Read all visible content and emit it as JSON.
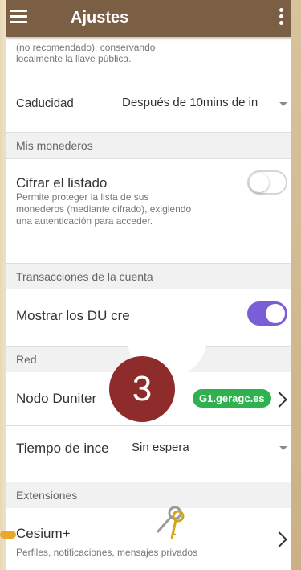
{
  "appbar": {
    "title": "Ajustes"
  },
  "top_note": {
    "line1": "(no recomendado), conservando",
    "line2": "localmente la llave pública."
  },
  "caducidad": {
    "label": "Caducidad",
    "value": "Después de 10mins de in"
  },
  "section_monederos": {
    "label": "Mis monederos"
  },
  "cifrar": {
    "label": "Cifrar el listado",
    "desc1": "Permite proteger la lista de sus",
    "desc2": "monederos (mediante cifrado), exigiendo",
    "desc3": "una autenticación para acceder."
  },
  "section_transacciones": {
    "label": "Transacciones de la cuenta"
  },
  "mostrar_du": {
    "label": "Mostrar los DU cre"
  },
  "section_red": {
    "label": "Red"
  },
  "nodo": {
    "label": "Nodo Duniter",
    "value": "G1.geragc.es"
  },
  "tiempo": {
    "label": "Tiempo de ince",
    "value": "Sin espera"
  },
  "section_extensiones": {
    "label": "Extensiones"
  },
  "cesium": {
    "label": "Cesium+",
    "desc": "Perfiles, notificaciones, mensajes privados"
  },
  "overlay": {
    "step": "3"
  },
  "colors": {
    "appbar": "#7a5f44",
    "toggle_on": "#7b5ed6",
    "badge": "#2eb14e",
    "step": "#8e2b2b"
  }
}
